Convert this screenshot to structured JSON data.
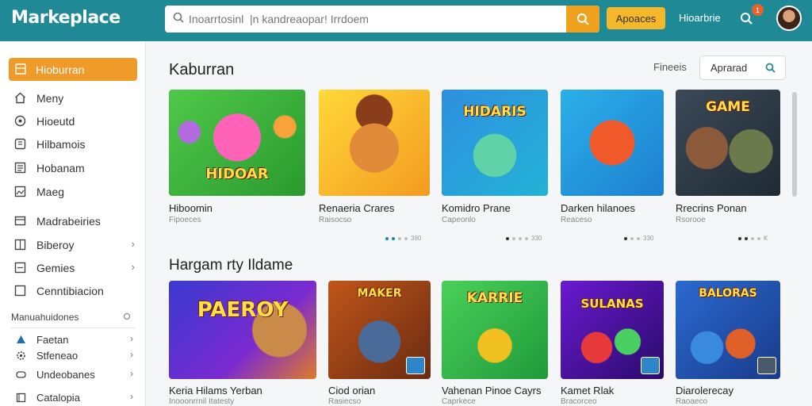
{
  "header": {
    "logo": "Markeplace",
    "search_placeholder": "Inoarrtosinl  |n kandreaopar! Irrdoem",
    "primary_button": "Apoaces",
    "link": "Hioarbrie",
    "notification_count": "1"
  },
  "sidebar": {
    "active": "Hioburran",
    "items": [
      {
        "label": "Meny",
        "icon": "home-icon"
      },
      {
        "label": "Hioeutd",
        "icon": "compass-icon"
      },
      {
        "label": "Hilbamois",
        "icon": "grid-icon"
      },
      {
        "label": "Hobanam",
        "icon": "list-icon"
      },
      {
        "label": "Maeg",
        "icon": "image-icon"
      },
      {
        "label": "Madrabeiries",
        "icon": "folder-icon"
      },
      {
        "label": "Biberoy",
        "icon": "library-icon"
      },
      {
        "label": "Gemies",
        "icon": "gamepad-icon"
      },
      {
        "label": "Cenntibiacion",
        "icon": "square-icon"
      }
    ],
    "section": "Manuahuidones",
    "sub_items": [
      {
        "label": "Faetan",
        "icon": "user-icon"
      },
      {
        "label": "Stfeneao",
        "icon": "gear-icon"
      },
      {
        "label": "Undeobanes",
        "icon": "controller-icon"
      },
      {
        "label": "Catalopia",
        "icon": "book-icon"
      }
    ]
  },
  "main": {
    "section1_title": "Kaburran",
    "sort_label": "Fineeis",
    "sort_value": "Aprarad",
    "section2_title": "Hargam rty Ildame",
    "row1": [
      {
        "title": "Hiboomin",
        "sub": "Fipoeces",
        "art": "HIDOAR"
      },
      {
        "title": "Renaeria Crares",
        "sub": "Raisocso",
        "art": ""
      },
      {
        "title": "Komidro Prane",
        "sub": "Capeonlo",
        "art": "HIDARIS"
      },
      {
        "title": "Darken hilanoes",
        "sub": "Reaceso",
        "art": ""
      },
      {
        "title": "Rrecrins Ponan",
        "sub": "Rsorooe",
        "art": "GAME"
      }
    ],
    "row1_dots": [
      "390",
      "330",
      "330",
      "K"
    ],
    "row2": [
      {
        "title": "Keria Hilams Yerban",
        "sub": "Inooonrrnil Itatesty",
        "art": "PAEROY"
      },
      {
        "title": "Ciod orian",
        "sub": "Rasiecso",
        "art": "MAKER"
      },
      {
        "title": "Vahenan Pinoe Cayrs",
        "sub": "Caprkece",
        "art": "KARRIE"
      },
      {
        "title": "Kamet Rlak",
        "sub": "Bracorceo",
        "art": "SULANAS"
      },
      {
        "title": "Diarolerecay",
        "sub": "Raoaeco",
        "art": "BALORAS"
      }
    ]
  },
  "colors": {
    "header": "#1f8a95",
    "accent": "#f09a2a",
    "button": "#f5b82a"
  }
}
